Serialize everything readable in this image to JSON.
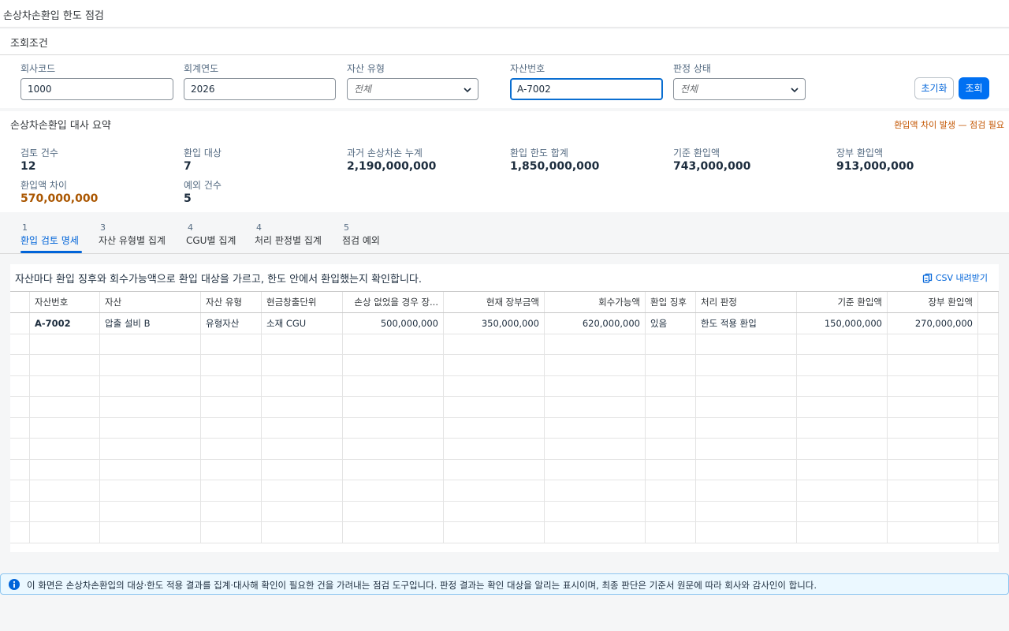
{
  "page": {
    "title": "손상차손환입 한도 점검"
  },
  "filters": {
    "section_title": "조회조건",
    "company_code": {
      "label": "회사코드",
      "value": "1000"
    },
    "fiscal_year": {
      "label": "회계연도",
      "value": "2026"
    },
    "asset_type": {
      "label": "자산 유형",
      "value": "전체"
    },
    "asset_no": {
      "label": "자산번호",
      "value": "A-7002"
    },
    "judgment_status": {
      "label": "판정 상태",
      "value": "전체"
    },
    "reset_label": "초기화",
    "search_label": "조회"
  },
  "summary": {
    "title": "손상차손환입 대사 요약",
    "warning": "환입액 차이 발생 — 점검 필요",
    "kpis": [
      {
        "label": "검토 건수",
        "value": "12"
      },
      {
        "label": "환입 대상",
        "value": "7"
      },
      {
        "label": "과거 손상차손 누계",
        "value": "2,190,000,000"
      },
      {
        "label": "환입 한도 합계",
        "value": "1,850,000,000"
      },
      {
        "label": "기준 환입액",
        "value": "743,000,000"
      },
      {
        "label": "장부 환입액",
        "value": "913,000,000"
      },
      {
        "label": "환입액 차이",
        "value": "570,000,000"
      },
      {
        "label": "예외 건수",
        "value": "5"
      }
    ]
  },
  "tabs": [
    {
      "count": "1",
      "label": "환입 검토 명세"
    },
    {
      "count": "3",
      "label": "자산 유형별 집계"
    },
    {
      "count": "4",
      "label": "CGU별 집계"
    },
    {
      "count": "4",
      "label": "처리 판정별 집계"
    },
    {
      "count": "5",
      "label": "점검 예외"
    }
  ],
  "panel": {
    "description": "자산마다 환입 징후와 회수가능액으로 환입 대상을 가르고, 한도 안에서 환입했는지 확인합니다.",
    "csv_label": "CSV 내려받기"
  },
  "table": {
    "columns": [
      "자산번호",
      "자산",
      "자산 유형",
      "현금창출단위",
      "손상 없었을 경우 장...",
      "현재 장부금액",
      "회수가능액",
      "환입 징후",
      "처리 판정",
      "기준 환입액",
      "장부 환입액"
    ],
    "rows": [
      [
        "A-7002",
        "압출 설비 B",
        "유형자산",
        "소재 CGU",
        "500,000,000",
        "350,000,000",
        "620,000,000",
        "있음",
        "한도 적용 환입",
        "150,000,000",
        "270,000,000"
      ]
    ]
  },
  "info": {
    "text": "이 화면은 손상차손환입의 대상·한도 적용 결과를 집계·대사해 확인이 필요한 건을 가려내는 점검 도구입니다. 판정 결과는 확인 대상을 알리는 표시이며, 최종 판단은 기준서 원문에 따라 회사와 감사인이 합니다."
  },
  "colors": {
    "accent": "#0070f2",
    "warning": "#c35500",
    "info_bg": "#ebf8ff"
  }
}
